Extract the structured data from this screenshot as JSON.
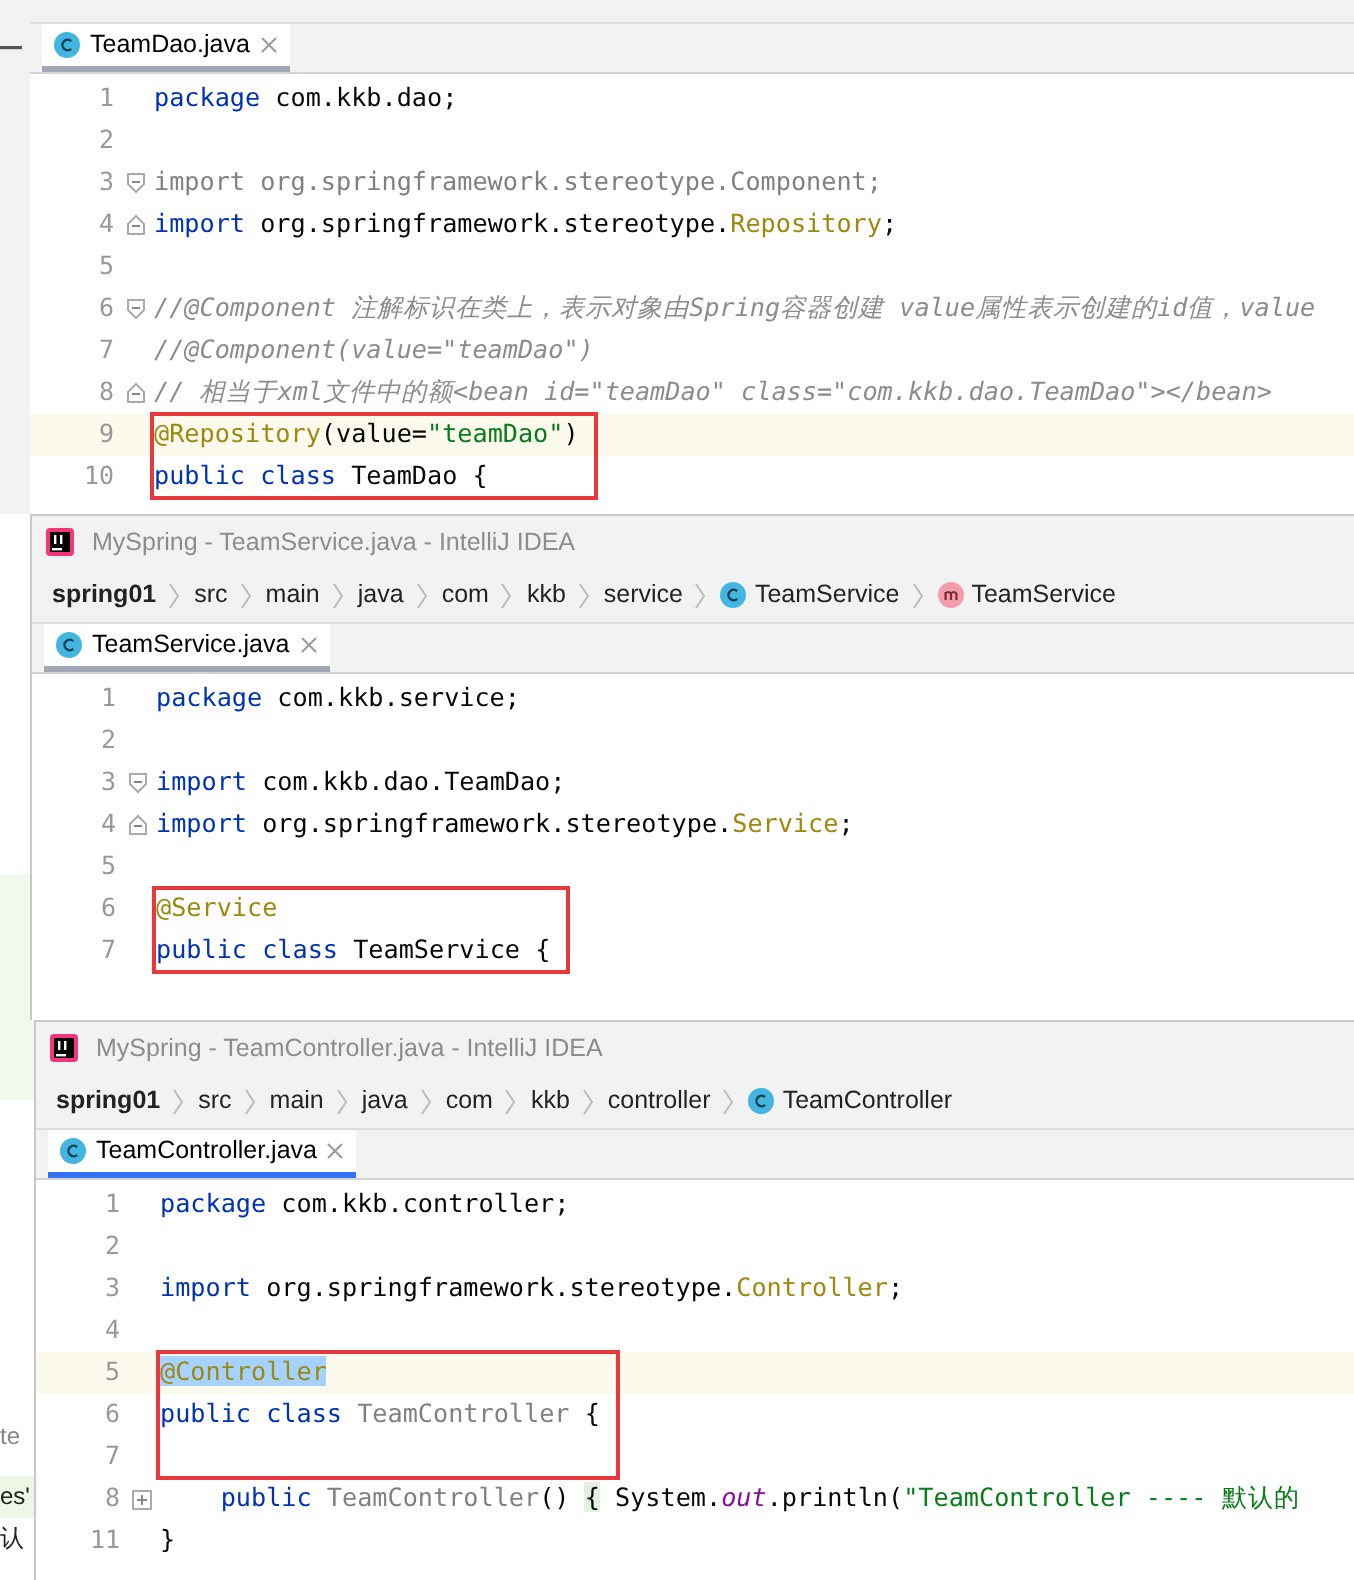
{
  "windows": [
    {
      "focused": false,
      "tab": {
        "label": "TeamDao.java",
        "selected": true
      },
      "lines": [
        {
          "number": "1",
          "kind": "plain",
          "current": false,
          "boxed": false,
          "tokens": [
            {
              "kind": "keyword",
              "text": "package"
            },
            {
              "kind": "plain",
              "text": " com.kkb.dao;"
            }
          ]
        },
        {
          "number": "2",
          "kind": "plain",
          "current": false,
          "boxed": false
        },
        {
          "number": "3",
          "kind": "fold_start",
          "current": false,
          "boxed": false,
          "tokens": [
            {
              "kind": "unused",
              "text": "import org.springframework.stereotype.Component;"
            }
          ]
        },
        {
          "number": "4",
          "kind": "fold_end",
          "current": false,
          "boxed": false,
          "tokens": [
            {
              "kind": "keyword",
              "text": "import"
            },
            {
              "kind": "plain",
              "text": " org.springframework.stereotype."
            },
            {
              "kind": "annotation",
              "text": "Repository"
            },
            {
              "kind": "plain",
              "text": ";"
            }
          ]
        },
        {
          "number": "5",
          "kind": "plain",
          "current": false,
          "boxed": false
        },
        {
          "number": "6",
          "kind": "fold_start",
          "current": false,
          "boxed": false,
          "tokens": [
            {
              "kind": "comment",
              "text": "//@Component 注解标识在类上，表示对象由Spring容器创建 value属性表示创建的id值，value"
            }
          ]
        },
        {
          "number": "7",
          "kind": "plain",
          "current": false,
          "boxed": false,
          "tokens": [
            {
              "kind": "comment",
              "text": "//@Component(value=\"teamDao\")"
            }
          ]
        },
        {
          "number": "8",
          "kind": "fold_end",
          "current": false,
          "boxed": false,
          "tokens": [
            {
              "kind": "comment",
              "text": "// 相当于xml文件中的额<bean id=\"teamDao\" class=\"com.kkb.dao.TeamDao\"></bean>"
            }
          ]
        },
        {
          "number": "9",
          "kind": "plain",
          "current": true,
          "boxed": true,
          "tokens": [
            {
              "kind": "annotation",
              "text": "@Repository"
            },
            {
              "kind": "plain",
              "text": "(value="
            },
            {
              "kind": "string",
              "text": "\"teamDao\""
            },
            {
              "kind": "plain",
              "text": ")"
            }
          ]
        },
        {
          "number": "10",
          "kind": "plain",
          "current": false,
          "boxed": true,
          "tokens": [
            {
              "kind": "keyword",
              "text": "public class"
            },
            {
              "kind": "plain",
              "text": " TeamDao {"
            }
          ]
        }
      ]
    },
    {
      "focused": false,
      "title": "MySpring - TeamService.java - IntelliJ IDEA",
      "breadcrumb": [
        {
          "label": "spring01",
          "kind": "module"
        },
        {
          "label": "src"
        },
        {
          "label": "main"
        },
        {
          "label": "java"
        },
        {
          "label": "com"
        },
        {
          "label": "kkb"
        },
        {
          "label": "service"
        },
        {
          "label": "TeamService",
          "kind": "class"
        },
        {
          "label": "TeamService",
          "kind": "method"
        }
      ],
      "tab": {
        "label": "TeamService.java",
        "selected": true
      },
      "lines": [
        {
          "number": "1",
          "kind": "plain",
          "current": false,
          "boxed": false,
          "tokens": [
            {
              "kind": "keyword",
              "text": "package"
            },
            {
              "kind": "plain",
              "text": " com.kkb.service;"
            }
          ]
        },
        {
          "number": "2",
          "kind": "plain",
          "current": false,
          "boxed": false
        },
        {
          "number": "3",
          "kind": "fold_start",
          "current": false,
          "boxed": false,
          "tokens": [
            {
              "kind": "keyword",
              "text": "import"
            },
            {
              "kind": "plain",
              "text": " com.kkb.dao.TeamDao;"
            }
          ]
        },
        {
          "number": "4",
          "kind": "fold_end",
          "current": false,
          "boxed": false,
          "tokens": [
            {
              "kind": "keyword",
              "text": "import"
            },
            {
              "kind": "plain",
              "text": " org.springframework.stereotype."
            },
            {
              "kind": "annotation",
              "text": "Service"
            },
            {
              "kind": "plain",
              "text": ";"
            }
          ]
        },
        {
          "number": "5",
          "kind": "plain",
          "current": false,
          "boxed": false
        },
        {
          "number": "6",
          "kind": "plain",
          "current": false,
          "boxed": true,
          "tokens": [
            {
              "kind": "annotation",
              "text": "@Service"
            }
          ]
        },
        {
          "number": "7",
          "kind": "plain",
          "current": false,
          "boxed": true,
          "tokens": [
            {
              "kind": "keyword",
              "text": "public class"
            },
            {
              "kind": "plain",
              "text": " TeamService {"
            }
          ]
        }
      ]
    },
    {
      "focused": true,
      "title": "MySpring - TeamController.java - IntelliJ IDEA",
      "breadcrumb": [
        {
          "label": "spring01",
          "kind": "module"
        },
        {
          "label": "src"
        },
        {
          "label": "main"
        },
        {
          "label": "java"
        },
        {
          "label": "com"
        },
        {
          "label": "kkb"
        },
        {
          "label": "controller"
        },
        {
          "label": "TeamController",
          "kind": "class"
        }
      ],
      "tab": {
        "label": "TeamController.java",
        "selected": true
      },
      "side_fragments": [
        "te",
        "es'",
        "认"
      ],
      "lines": [
        {
          "number": "1",
          "kind": "plain",
          "current": false,
          "boxed": false,
          "tokens": [
            {
              "kind": "keyword",
              "text": "package"
            },
            {
              "kind": "plain",
              "text": " com.kkb.controller;"
            }
          ]
        },
        {
          "number": "2",
          "kind": "plain",
          "current": false,
          "boxed": false
        },
        {
          "number": "3",
          "kind": "plain",
          "current": false,
          "boxed": false,
          "tokens": [
            {
              "kind": "keyword",
              "text": "import"
            },
            {
              "kind": "plain",
              "text": " org.springframework.stereotype."
            },
            {
              "kind": "annotation",
              "text": "Controller"
            },
            {
              "kind": "plain",
              "text": ";"
            }
          ]
        },
        {
          "number": "4",
          "kind": "plain",
          "current": false,
          "boxed": false
        },
        {
          "number": "5",
          "kind": "plain",
          "current": true,
          "boxed": true,
          "tokens": [
            {
              "kind": "selected_annotation",
              "text": "@Controller"
            }
          ]
        },
        {
          "number": "6",
          "kind": "plain",
          "current": false,
          "boxed": true,
          "tokens": [
            {
              "kind": "keyword",
              "text": "public class"
            },
            {
              "kind": "unused",
              "text": " TeamController"
            },
            {
              "kind": "plain",
              "text": " {"
            }
          ]
        },
        {
          "number": "7",
          "kind": "plain",
          "current": false,
          "boxed": true
        },
        {
          "number": "8",
          "kind": "folded",
          "current": false,
          "boxed": false,
          "tokens": [
            {
              "kind": "keyword",
              "text": "    public"
            },
            {
              "kind": "unused",
              "text": " TeamController"
            },
            {
              "kind": "plain",
              "text": "() "
            },
            {
              "kind": "matched_brace",
              "text": "{"
            },
            {
              "kind": "plain",
              "text": " System."
            },
            {
              "kind": "static_field",
              "text": "out"
            },
            {
              "kind": "plain",
              "text": ".println("
            },
            {
              "kind": "string",
              "text": "\"TeamController ---- 默认的"
            }
          ]
        },
        {
          "number": "11",
          "kind": "plain",
          "current": false,
          "boxed": false,
          "tokens": [
            {
              "kind": "plain",
              "text": "}"
            }
          ]
        }
      ]
    }
  ]
}
